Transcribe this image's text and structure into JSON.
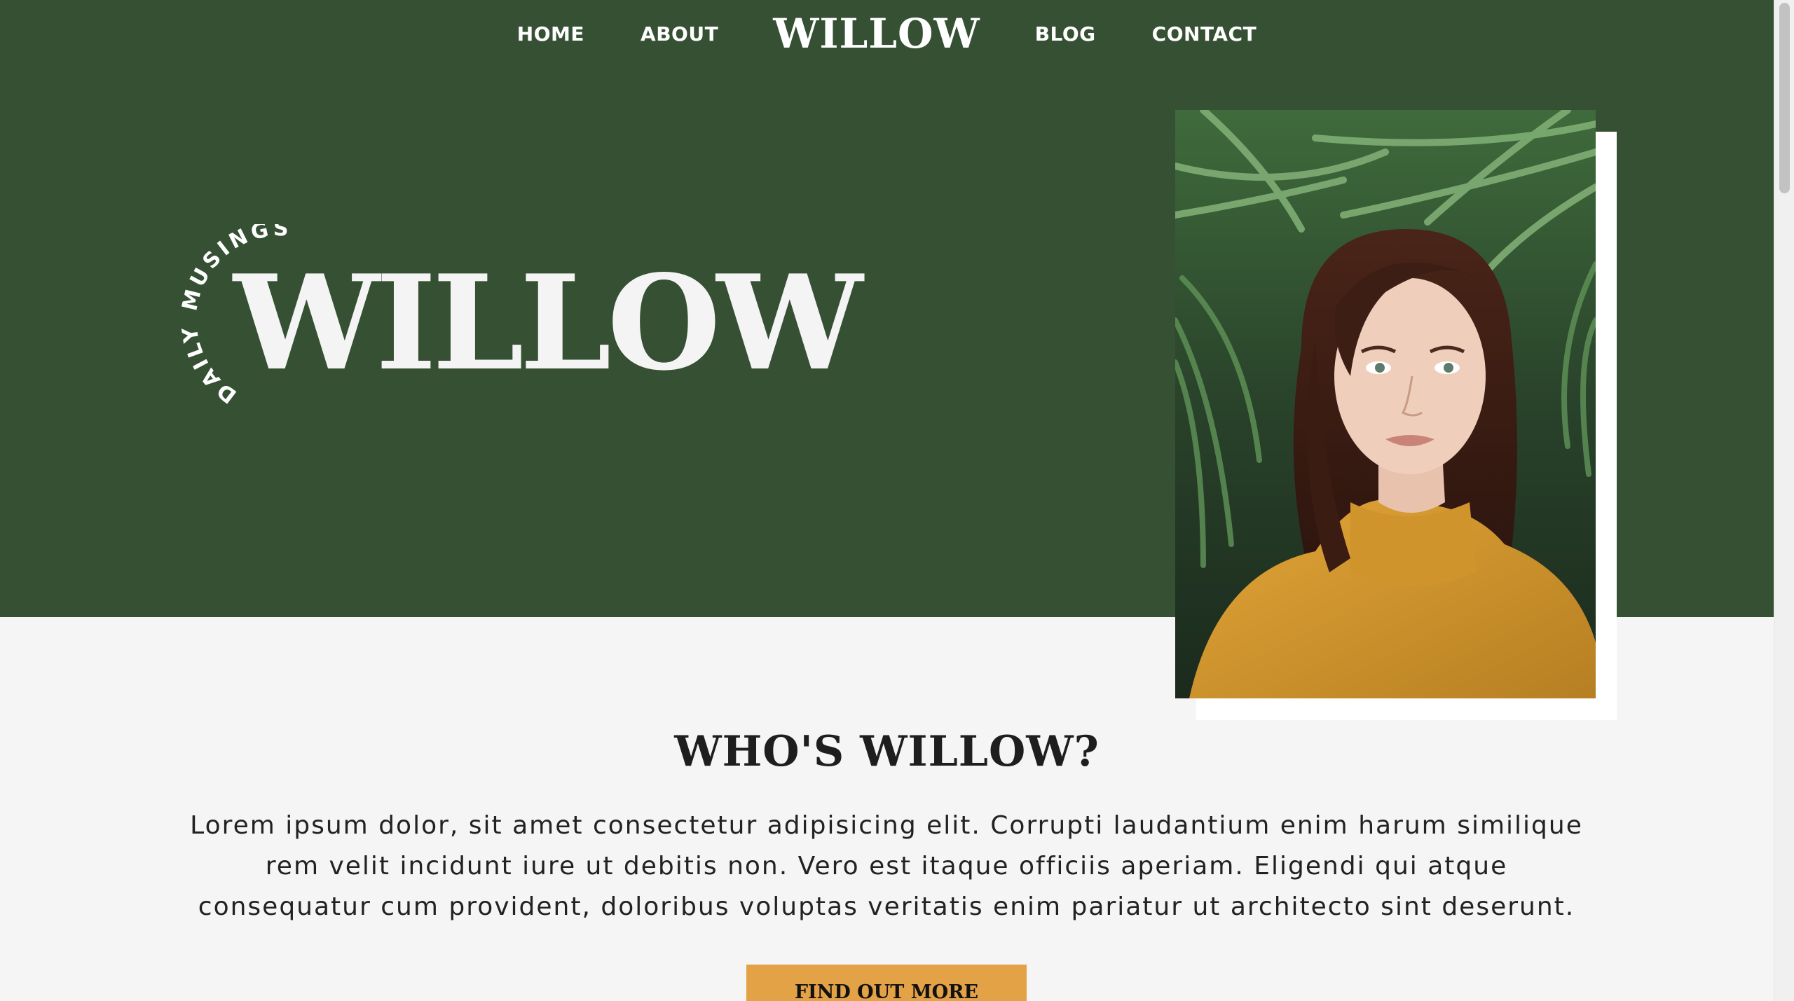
{
  "nav": {
    "links": [
      "HOME",
      "ABOUT",
      "BLOG",
      "CONTACT"
    ],
    "brand": "WILLOW"
  },
  "hero": {
    "tagline": "DAILY MUSINGS OF",
    "title": "WILLOW",
    "photo_alt": "Woman in a mustard jacket among palm leaves"
  },
  "about": {
    "heading": "WHO'S WILLOW?",
    "body": "Lorem ipsum dolor, sit amet consectetur adipisicing elit. Corrupti laudantium enim harum similique rem velit incidunt iure ut debitis non. Vero est itaque officiis aperiam. Eligendi qui atque consequatur cum provident, doloribus voluptas veritatis enim pariatur ut architecto sint deserunt.",
    "button_label": "FIND OUT MORE"
  },
  "colors": {
    "hero_bg": "#365033",
    "page_bg": "#f5f5f5",
    "accent": "#e3a246",
    "text_dark": "#1e1e1e",
    "text_light": "#ffffff"
  }
}
